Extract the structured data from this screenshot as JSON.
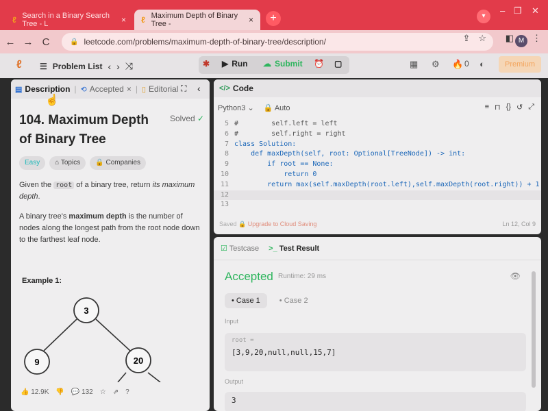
{
  "browser": {
    "tabs": [
      {
        "title": "Search in a Binary Search Tree - L",
        "close": "×"
      },
      {
        "title": "Maximum Depth of Binary Tree -",
        "close": "×"
      }
    ],
    "new_tab": "+",
    "url": "leetcode.com/problems/maximum-depth-of-binary-tree/description/",
    "profile_initial": "M"
  },
  "navbar": {
    "problem_list": "Problem List",
    "run": "Run",
    "submit": "Submit",
    "coins": "0",
    "premium": "Premium"
  },
  "left_panel": {
    "tabs": [
      {
        "label": "Description"
      },
      {
        "label": "Accepted"
      },
      {
        "label": "Editorial"
      }
    ],
    "title": "104. Maximum Depth of Binary Tree",
    "solved": "Solved",
    "chips": {
      "difficulty": "Easy",
      "topics": "Topics",
      "companies": "Companies"
    },
    "desc1_pre": "Given the ",
    "desc1_code": "root",
    "desc1_mid": " of a binary tree, return ",
    "desc1_em": "its maximum depth",
    "desc1_end": ".",
    "desc2_pre": "A binary tree's ",
    "desc2_bold": "maximum depth",
    "desc2_end": " is the number of nodes along the longest path from the root node down to the farthest leaf node.",
    "example_label": "Example 1:",
    "tree_nodes": [
      "3",
      "9",
      "20"
    ],
    "footer": {
      "likes": "12.9K",
      "comments": "132"
    }
  },
  "code_panel": {
    "header": "Code",
    "language": "Python3",
    "mode": "Auto",
    "lines": [
      {
        "n": "5",
        "code": "#        self.left = left"
      },
      {
        "n": "6",
        "code": "#        self.right = right"
      },
      {
        "n": "7",
        "code": "class Solution:"
      },
      {
        "n": "8",
        "code": "    def maxDepth(self, root: Optional[TreeNode]) -> int:"
      },
      {
        "n": "9",
        "code": "        if root == None:"
      },
      {
        "n": "10",
        "code": "            return 0"
      },
      {
        "n": "11",
        "code": "        return max(self.maxDepth(root.left),self.maxDepth(root.right)) + 1"
      },
      {
        "n": "12",
        "code": ""
      },
      {
        "n": "13",
        "code": ""
      }
    ],
    "saved": "Saved",
    "upgrade": "Upgrade to Cloud Saving",
    "cursor": "Ln 12, Col 9"
  },
  "result_panel": {
    "tabs": [
      {
        "label": "Testcase"
      },
      {
        "label": "Test Result"
      }
    ],
    "status": "Accepted",
    "runtime": "Runtime: 29 ms",
    "cases": [
      "Case 1",
      "Case 2"
    ],
    "input_label": "Input",
    "input_var": "root =",
    "input_value": "[3,9,20,null,null,15,7]",
    "output_label": "Output",
    "output_value": "3"
  },
  "colors": {
    "accent_green": "#2db55d",
    "brand_red": "#e23b4a",
    "leetcode_orange": "#e0732a"
  }
}
